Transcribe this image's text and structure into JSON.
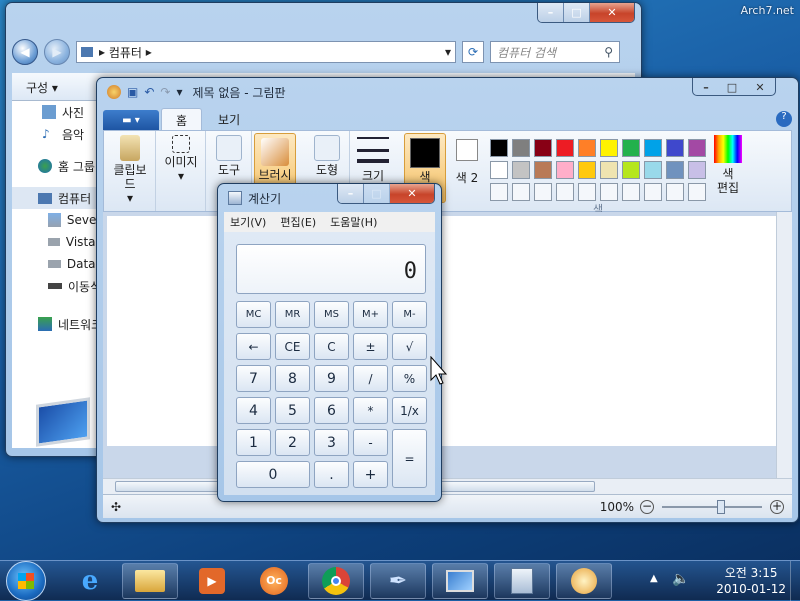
{
  "watermark": "Arch7.net",
  "explorer": {
    "breadcrumb": "컴퓨터",
    "search_placeholder": "컴퓨터 검색",
    "toolbar_label": "구성",
    "sidebar": [
      "사진",
      "음악",
      "홈 그룹",
      "컴퓨터",
      "Seven",
      "Vista (",
      "Data (",
      "이동식",
      "네트워크"
    ]
  },
  "paint": {
    "title": "제목 없음 - 그림판",
    "tabs": [
      "홈",
      "보기"
    ],
    "groups": {
      "clipboard": "클립보드",
      "image": "이미지",
      "tools": "도구",
      "brushes": "브러시",
      "shapes": "도형",
      "size": "크기",
      "color1": "색",
      "color2": "색\n2",
      "colors_group": "색",
      "edit_colors": "색\n편집"
    },
    "color1_label": "색",
    "color2_label": "색 2",
    "palette_row1": [
      "#000000",
      "#7f7f7f",
      "#880015",
      "#ed1c24",
      "#ff7f27",
      "#fff200",
      "#22b14c",
      "#00a2e8",
      "#3f48cc",
      "#a349a4"
    ],
    "palette_row2": [
      "#ffffff",
      "#c3c3c3",
      "#b97a57",
      "#ffaec9",
      "#ffc90e",
      "#efe4b0",
      "#b5e61d",
      "#99d9ea",
      "#7092be",
      "#c8bfe7"
    ],
    "zoom": "100%"
  },
  "calc": {
    "title": "계산기",
    "menu": [
      "보기(V)",
      "편집(E)",
      "도움말(H)"
    ],
    "display": "0",
    "keys": {
      "r1": [
        "MC",
        "MR",
        "MS",
        "M+",
        "M-"
      ],
      "r2": [
        "←",
        "CE",
        "C",
        "±",
        "√"
      ],
      "r3": [
        "7",
        "8",
        "9",
        "/",
        "%"
      ],
      "r4": [
        "4",
        "5",
        "6",
        "*",
        "1/x"
      ],
      "r5": [
        "1",
        "2",
        "3",
        "-",
        "="
      ],
      "r6": [
        "0",
        ".",
        "+"
      ]
    }
  },
  "taskbar": {
    "time": "오전 3:15",
    "date": "2010-01-12"
  }
}
